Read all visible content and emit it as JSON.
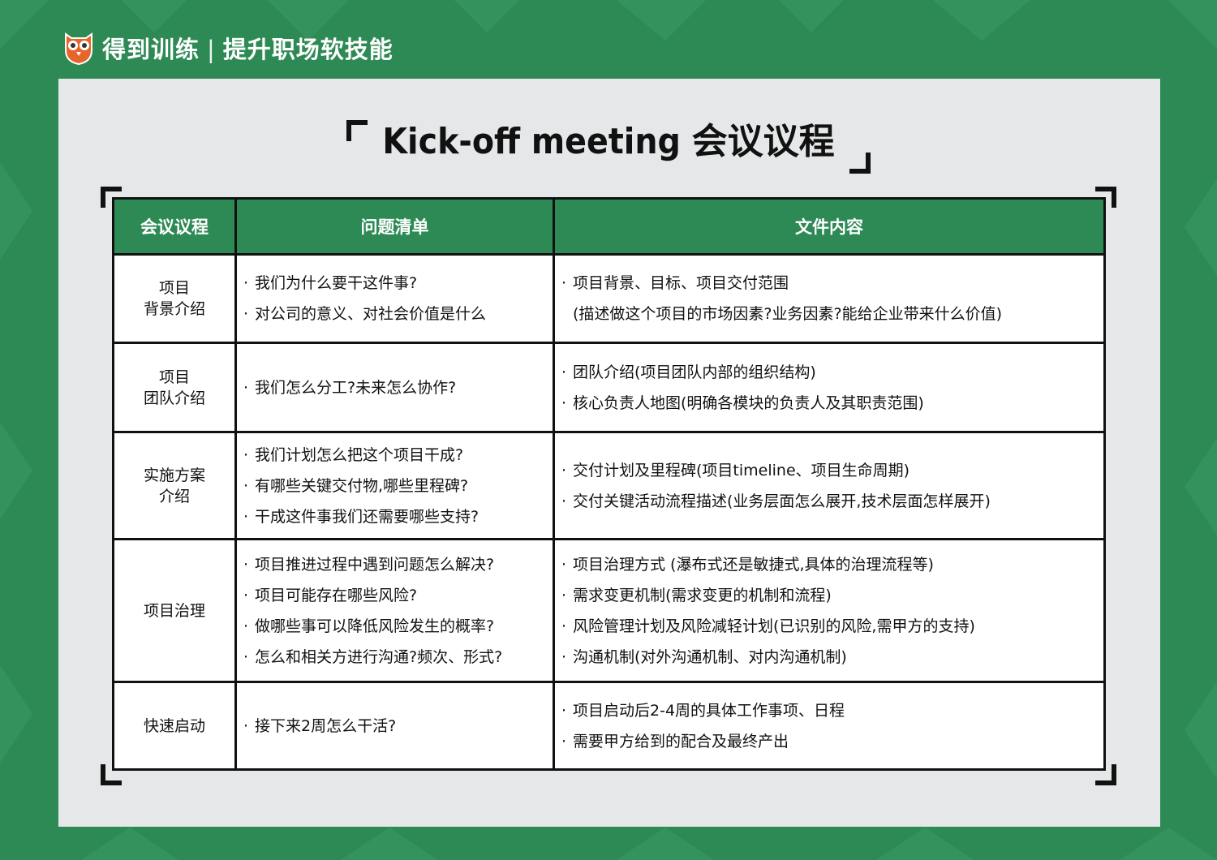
{
  "header": {
    "brand": "得到训练",
    "separator": "|",
    "slogan": "提升职场软技能",
    "logo": "owl-logo-icon"
  },
  "title": "Kick-off meeting 会议议程",
  "colors": {
    "background": "#2e8a55",
    "panel": "#e5e7e8",
    "header_row": "#2e8a55",
    "border": "#111111"
  },
  "table": {
    "headers": [
      "会议议程",
      "问题清单",
      "文件内容"
    ],
    "rows": [
      {
        "agenda": [
          "项目",
          "背景介绍"
        ],
        "questions": [
          "我们为什么要干这件事?",
          "对公司的意义、对社会价值是什么"
        ],
        "files": [
          {
            "text": "项目背景、目标、项目交付范围",
            "sub": false
          },
          {
            "text": "(描述做这个项目的市场因素?业务因素?能给企业带来什么价值)",
            "sub": true
          }
        ]
      },
      {
        "agenda": [
          "项目",
          "团队介绍"
        ],
        "questions": [
          "我们怎么分工?未来怎么协作?"
        ],
        "files": [
          {
            "text": "团队介绍(项目团队内部的组织结构)",
            "sub": false
          },
          {
            "text": "核心负责人地图(明确各模块的负责人及其职责范围)",
            "sub": false
          }
        ]
      },
      {
        "agenda": [
          "实施方案",
          "介绍"
        ],
        "questions": [
          "我们计划怎么把这个项目干成?",
          "有哪些关键交付物,哪些里程碑?",
          "干成这件事我们还需要哪些支持?"
        ],
        "files": [
          {
            "text": "交付计划及里程碑(项目timeline、项目生命周期)",
            "sub": false
          },
          {
            "text": "交付关键活动流程描述(业务层面怎么展开,技术层面怎样展开)",
            "sub": false
          }
        ]
      },
      {
        "agenda": [
          "项目治理"
        ],
        "questions": [
          "项目推进过程中遇到问题怎么解决?",
          "项目可能存在哪些风险?",
          "做哪些事可以降低风险发生的概率?",
          "怎么和相关方进行沟通?频次、形式?"
        ],
        "files": [
          {
            "text": "项目治理方式 (瀑布式还是敏捷式,具体的治理流程等)",
            "sub": false
          },
          {
            "text": "需求变更机制(需求变更的机制和流程)",
            "sub": false
          },
          {
            "text": "风险管理计划及风险减轻计划(已识别的风险,需甲方的支持)",
            "sub": false
          },
          {
            "text": "沟通机制(对外沟通机制、对内沟通机制)",
            "sub": false
          }
        ]
      },
      {
        "agenda": [
          "快速启动"
        ],
        "questions": [
          "接下来2周怎么干活?"
        ],
        "files": [
          {
            "text": "项目启动后2-4周的具体工作事项、日程",
            "sub": false
          },
          {
            "text": "需要甲方给到的配合及最终产出",
            "sub": false
          }
        ]
      }
    ],
    "bullet": "·"
  }
}
